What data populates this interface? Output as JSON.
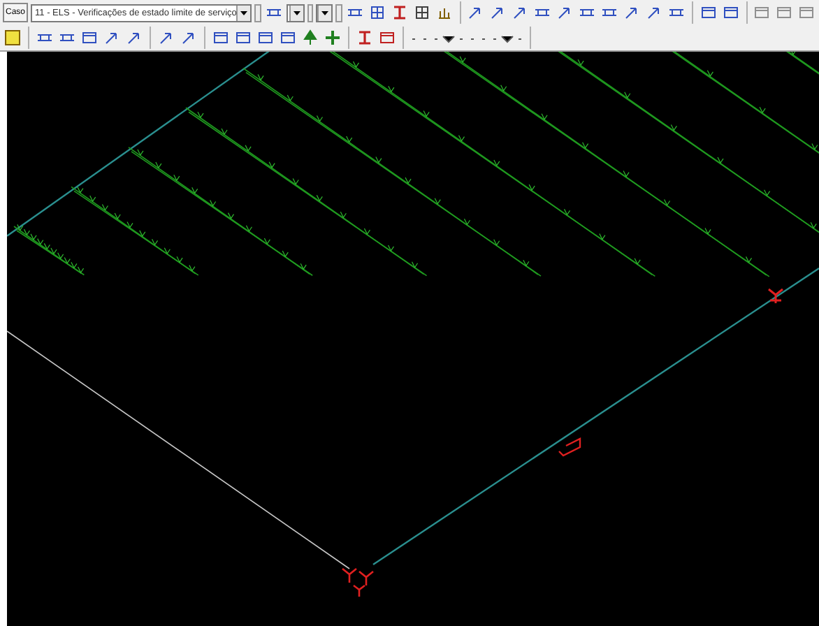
{
  "toolbar": {
    "case_button": "Caso",
    "case_combo": {
      "value": "11 - ELS - Verificações de estado limite de serviço"
    }
  }
}
